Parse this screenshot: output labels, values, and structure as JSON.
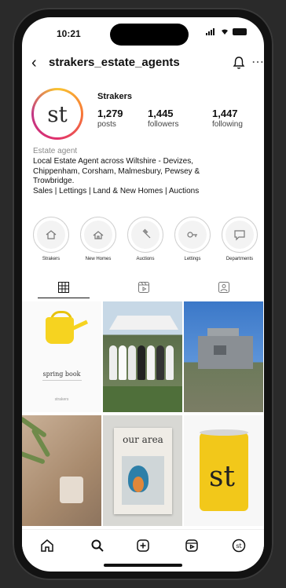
{
  "status": {
    "time": "10:21"
  },
  "profile": {
    "username": "strakers_estate_agents",
    "display_name": "Strakers",
    "avatar_text": "st",
    "stats": [
      {
        "value": "1,279",
        "label": "posts"
      },
      {
        "value": "1,445",
        "label": "followers"
      },
      {
        "value": "1,447",
        "label": "following"
      }
    ],
    "category": "Estate agent",
    "bio": [
      "Local Estate Agent across Wiltshire - Devizes,",
      "Chippenham, Corsham, Malmesbury, Pewsey &",
      "Trowbridge.",
      "Sales | Lettings | Land & New Homes | Auctions"
    ]
  },
  "highlights": [
    {
      "label": "Strakers",
      "icon": "house-icon"
    },
    {
      "label": "New Homes",
      "icon": "new-home-icon"
    },
    {
      "label": "Auctions",
      "icon": "gavel-icon"
    },
    {
      "label": "Lettings",
      "icon": "key-icon"
    },
    {
      "label": "Departments",
      "icon": "chat-icon"
    }
  ],
  "posts": {
    "spring_text": "spring book",
    "spring_small": "strakers",
    "magazine_title": "our area",
    "tin_logo": "st"
  },
  "colors": {
    "accent_yellow": "#f6d320",
    "ring": [
      "#f9c531",
      "#f77737",
      "#e1306c",
      "#c13584"
    ]
  }
}
